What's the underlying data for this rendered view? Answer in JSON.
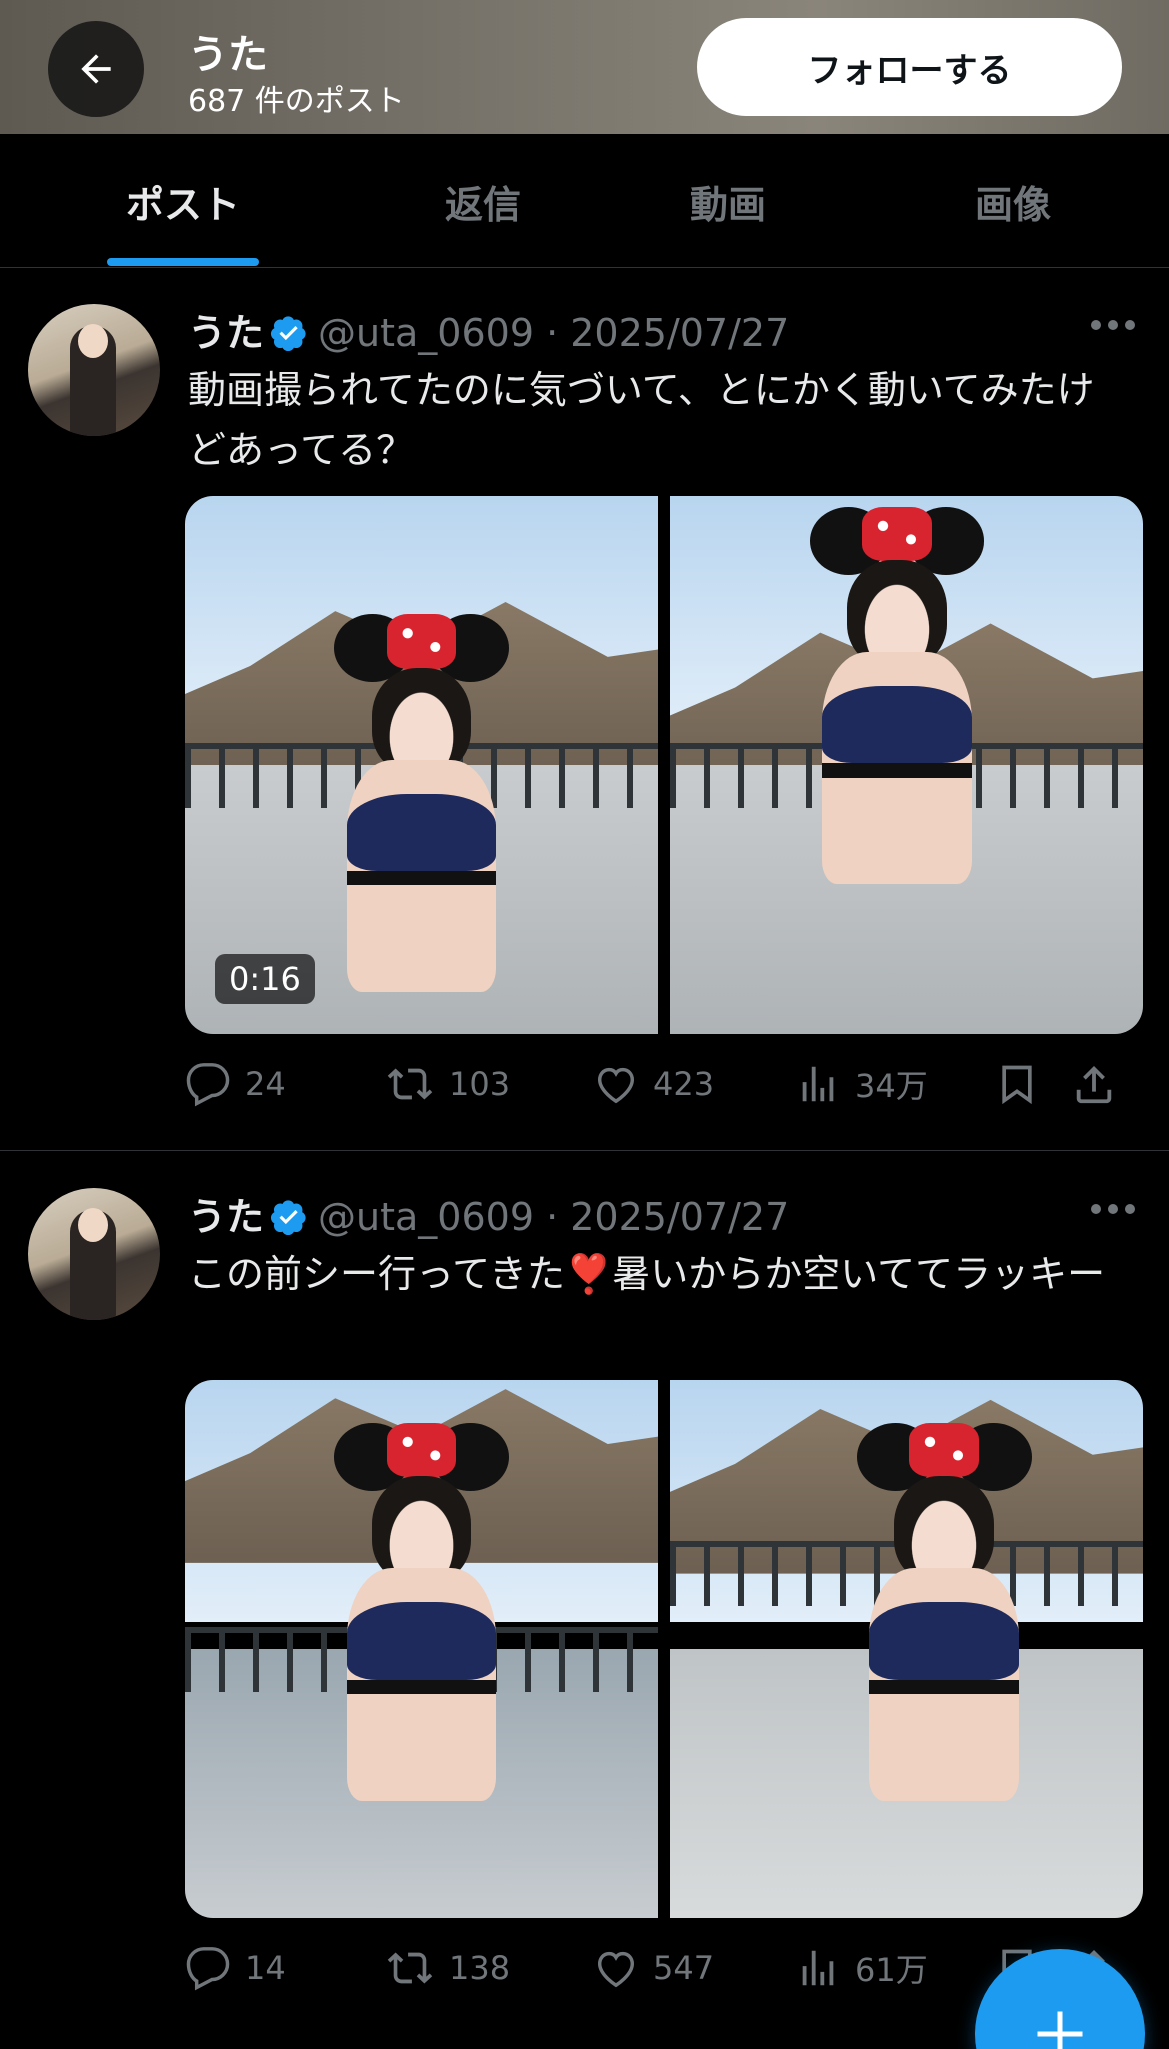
{
  "header": {
    "name": "うた",
    "post_count": "687 件のポスト",
    "follow_label": "フォローする"
  },
  "tabs": [
    {
      "label": "ポスト",
      "active": true
    },
    {
      "label": "返信",
      "active": false
    },
    {
      "label": "動画",
      "active": false
    },
    {
      "label": "画像",
      "active": false
    }
  ],
  "posts": [
    {
      "name": "うた",
      "handle": "@uta_0609",
      "date": "2025/07/27",
      "text": "動画撮られてたのに気づいて、とにかく動いてみたけどあってる？",
      "video_duration": "0:16",
      "replies": "24",
      "reposts": "103",
      "likes": "423",
      "views": "34万"
    },
    {
      "name": "うた",
      "handle": "@uta_0609",
      "date": "2025/07/27",
      "text": "この前シー行ってきた❣️暑いからか空いててラッキー",
      "replies": "14",
      "reposts": "138",
      "likes": "547",
      "views": "61万"
    }
  ],
  "colors": {
    "accent": "#1d9bf0",
    "muted": "#71767b",
    "text": "#e7e9ea",
    "background": "#000000"
  },
  "icons": [
    "back-arrow-icon",
    "verified-badge-icon",
    "more-icon",
    "reply-icon",
    "repost-icon",
    "like-icon",
    "views-icon",
    "bookmark-icon",
    "share-icon",
    "compose-plus-icon"
  ]
}
